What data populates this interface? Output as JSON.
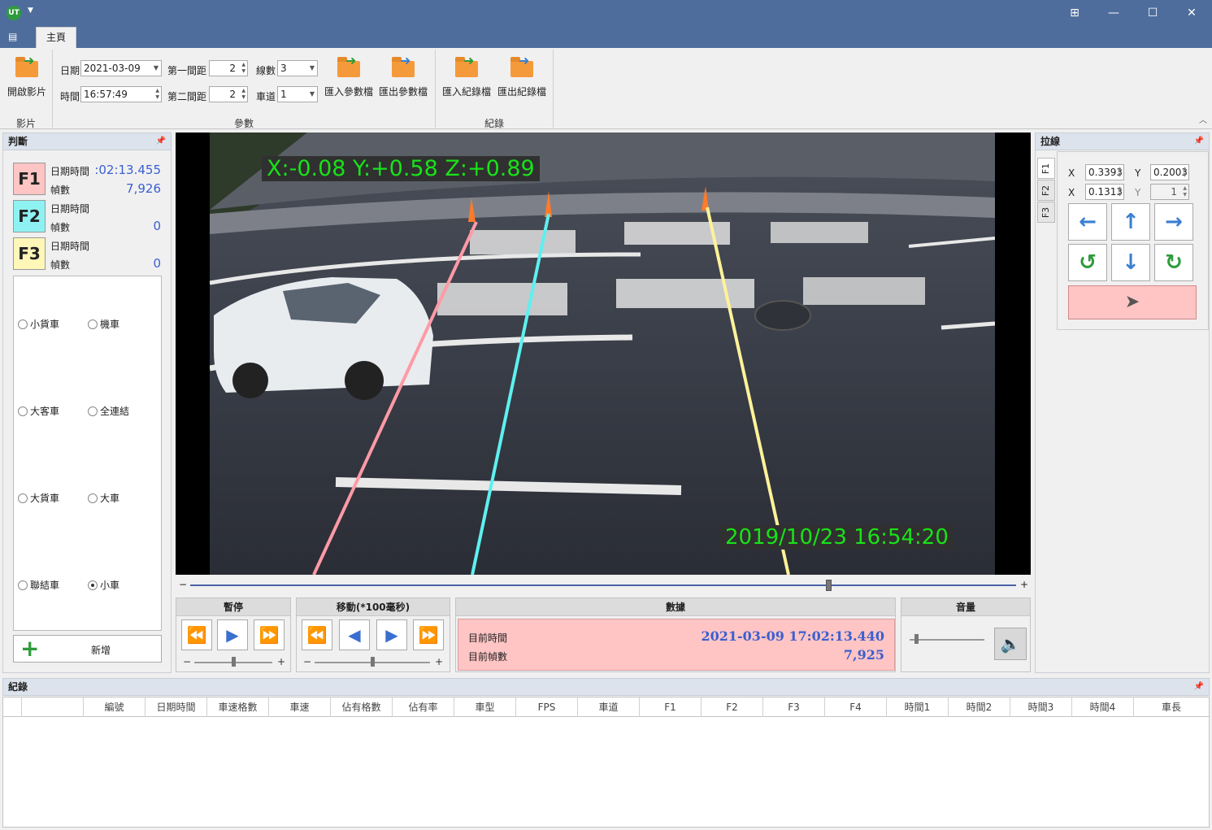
{
  "ribbon": {
    "tab": "主頁",
    "video_group": {
      "open_label": "開啟影片",
      "group_label": "影片"
    },
    "params_group": {
      "date_label": "日期",
      "date_value": "2021-03-09",
      "time_label": "時間",
      "time_value": "16:57:49",
      "gap1_label": "第一間距",
      "gap1_value": "2",
      "gap2_label": "第二間距",
      "gap2_value": "2",
      "lines_label": "線數",
      "lines_value": "3",
      "lane_label": "車道",
      "lane_value": "1",
      "import_params": "匯入參數檔",
      "export_params": "匯出參數檔",
      "group_label": "參數"
    },
    "records_group": {
      "import_records": "匯入紀錄檔",
      "export_records": "匯出紀錄檔",
      "group_label": "紀錄"
    }
  },
  "judge": {
    "title": "判斷",
    "f1": {
      "badge": "F1",
      "datetime_label": "日期時間",
      "datetime_value": ":02:13.455",
      "frames_label": "幀數",
      "frames_value": "7,926",
      "color": "#ffc4c4"
    },
    "f2": {
      "badge": "F2",
      "datetime_label": "日期時間",
      "datetime_value": "",
      "frames_label": "幀數",
      "frames_value": "0",
      "color": "#8ff2f2"
    },
    "f3": {
      "badge": "F3",
      "datetime_label": "日期時間",
      "datetime_value": "",
      "frames_label": "幀數",
      "frames_value": "0",
      "color": "#fff7b8"
    },
    "vehicles": [
      {
        "label": "小貨車",
        "selected": false
      },
      {
        "label": "機車",
        "selected": false
      },
      {
        "label": "大客車",
        "selected": false
      },
      {
        "label": "全連結",
        "selected": false
      },
      {
        "label": "大貨車",
        "selected": false
      },
      {
        "label": "大車",
        "selected": false
      },
      {
        "label": "聯結車",
        "selected": false
      },
      {
        "label": "小車",
        "selected": true
      }
    ],
    "add_label": "新增"
  },
  "video": {
    "overlay_xyz": "X:-0.08 Y:+0.58 Z:+0.89",
    "overlay_time": "2019/10/23 16:54:20",
    "seek_position": 0.773
  },
  "controls": {
    "pause_title": "暫停",
    "move_title": "移動(*100毫秒)",
    "data_title": "數據",
    "current_time_label": "目前時間",
    "current_time_value": "2021-03-09 17:02:13.440",
    "current_frame_label": "目前幀數",
    "current_frame_value": "7,925",
    "volume_title": "音量",
    "minus": "−",
    "plus": "+"
  },
  "lines_panel": {
    "title": "拉線",
    "tabs": [
      "F1",
      "F2",
      "F3"
    ],
    "row1": {
      "x_label": "X",
      "x_value": "0.3393",
      "y_label": "Y",
      "y_value": "0.2003"
    },
    "row2": {
      "x_label": "X",
      "x_value": "0.1313",
      "y_label": "Y",
      "y_value": "1"
    }
  },
  "records": {
    "title": "紀錄",
    "columns": [
      "",
      "編號",
      "日期時間",
      "車速格數",
      "車速",
      "佔有格數",
      "佔有率",
      "車型",
      "FPS",
      "車道",
      "F1",
      "F2",
      "F3",
      "F4",
      "時間1",
      "時間2",
      "時間3",
      "時間4",
      "車長"
    ]
  }
}
